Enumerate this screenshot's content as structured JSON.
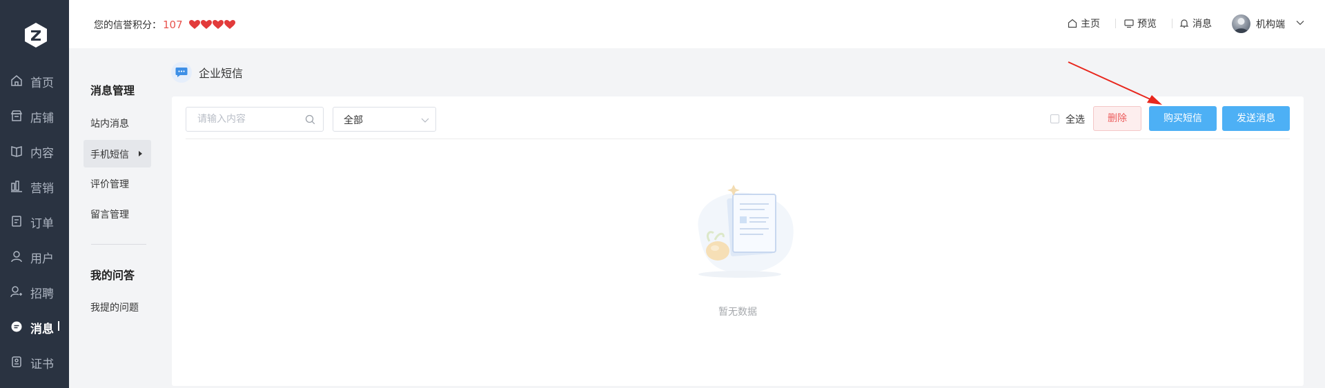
{
  "left_nav": {
    "items": [
      {
        "label": "首页",
        "icon": "home-icon"
      },
      {
        "label": "店铺",
        "icon": "shop-icon"
      },
      {
        "label": "内容",
        "icon": "book-icon"
      },
      {
        "label": "营销",
        "icon": "chart-icon"
      },
      {
        "label": "订单",
        "icon": "order-icon"
      },
      {
        "label": "用户",
        "icon": "user-icon"
      },
      {
        "label": "招聘",
        "icon": "recruit-icon"
      },
      {
        "label": "消息",
        "icon": "message-icon",
        "active": true
      },
      {
        "label": "证书",
        "icon": "certificate-icon"
      }
    ]
  },
  "header": {
    "credit_label": "您的信誉积分：",
    "credit_score": "107",
    "hearts": 4,
    "nav": [
      {
        "label": "主页",
        "icon": "home-icon"
      },
      {
        "label": "预览",
        "icon": "monitor-icon"
      },
      {
        "label": "消息",
        "icon": "bell-icon"
      }
    ],
    "user_name": "机构端"
  },
  "sub_sidebar": {
    "group1_title": "消息管理",
    "group1_items": [
      "站内消息",
      "手机短信",
      "评价管理",
      "留言管理"
    ],
    "active_item": "手机短信",
    "group2_title": "我的问答",
    "group2_items": [
      "我提的问题"
    ]
  },
  "page": {
    "title": "企业短信"
  },
  "toolbar": {
    "search_placeholder": "请输入内容",
    "filter_value": "全部",
    "select_all_label": "全选",
    "delete_label": "删除",
    "buy_label": "购买短信",
    "send_label": "发送消息"
  },
  "empty_state": {
    "text": "暂无数据"
  },
  "colors": {
    "nav_bg": "#2a3341",
    "primary": "#4db0f5",
    "danger": "#ec5d5d",
    "annotation_arrow": "#e8271d"
  }
}
